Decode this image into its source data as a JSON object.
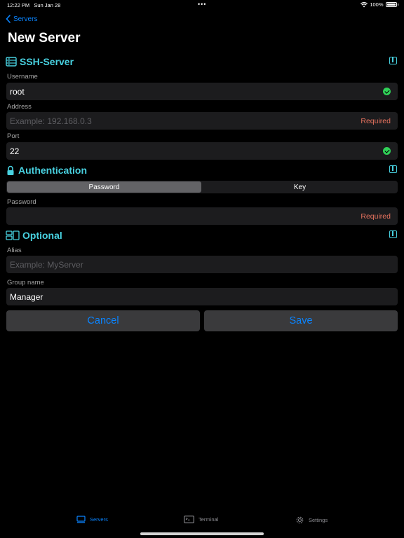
{
  "status": {
    "time": "12:22 PM",
    "date": "Sun Jan 28",
    "dots": "•••",
    "battery": "100%"
  },
  "nav": {
    "back_label": "Servers",
    "title": "New Server"
  },
  "sections": {
    "ssh": {
      "title": "SSH-Server",
      "username_label": "Username",
      "username_value": "root",
      "address_label": "Address",
      "address_placeholder": "Example: 192.168.0.3",
      "address_required": "Required",
      "port_label": "Port",
      "port_value": "22"
    },
    "auth": {
      "title": "Authentication",
      "segments": [
        "Password",
        "Key"
      ],
      "selected": "Password",
      "password_label": "Password",
      "password_required": "Required"
    },
    "optional": {
      "title": "Optional",
      "alias_label": "Alias",
      "alias_placeholder": "Example: MyServer",
      "group_label": "Group name",
      "group_value": "Manager"
    }
  },
  "buttons": {
    "cancel": "Cancel",
    "save": "Save"
  },
  "tabbar": {
    "items": [
      {
        "label": "Servers",
        "icon": "servers-icon",
        "active": true
      },
      {
        "label": "Terminal",
        "icon": "terminal-icon",
        "active": false
      },
      {
        "label": "Settings",
        "icon": "gear-icon",
        "active": false
      }
    ]
  },
  "colors": {
    "accent": "#0a84ff",
    "section": "#48d1e0",
    "required": "#e9735f",
    "valid": "#30d158",
    "field_bg": "#1c1c1e"
  }
}
